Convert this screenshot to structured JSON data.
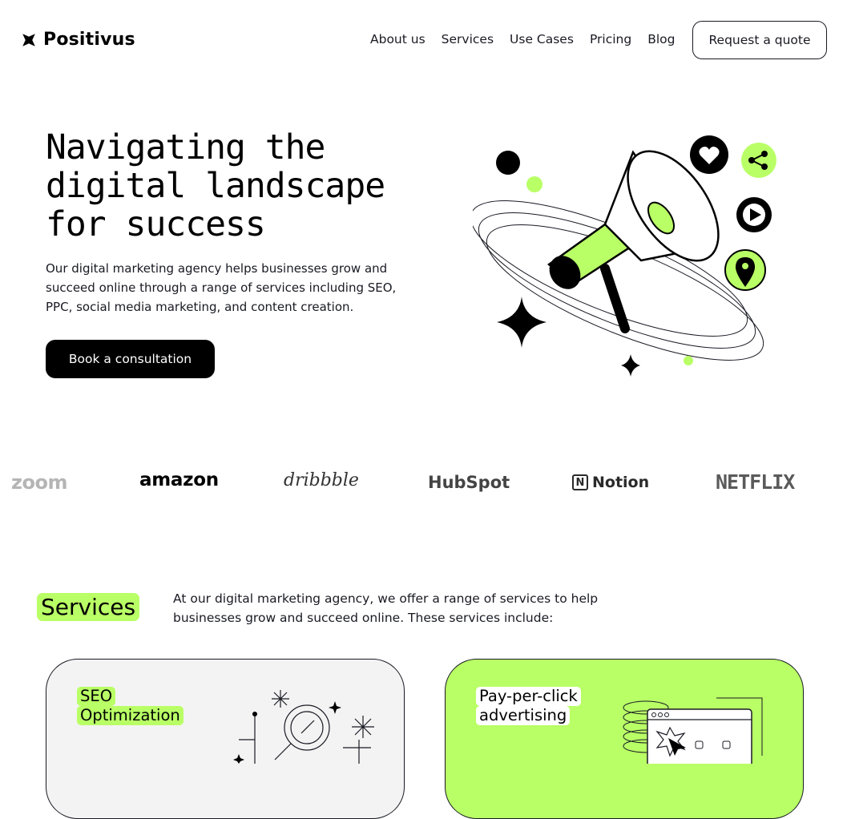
{
  "header": {
    "brand": "Positivus",
    "nav": [
      "About us",
      "Services",
      "Use Cases",
      "Pricing",
      "Blog"
    ],
    "quote_button": "Request a quote"
  },
  "hero": {
    "title": "Navigating the digital landscape for success",
    "description": "Our digital marketing agency helps businesses grow and succeed online through a range of services including SEO, PPC, social media marketing, and content creation.",
    "cta": "Book a consultation"
  },
  "logos": [
    "zoom",
    "amazon",
    "dribbble",
    "HubSpot",
    "Notion",
    "NETFLIX"
  ],
  "services": {
    "title": "Services",
    "description": "At our digital marketing agency, we offer a range of services to help businesses grow and succeed online. These services include:",
    "cards": [
      {
        "title_line1": "SEO",
        "title_line2": "Optimization"
      },
      {
        "title_line1": "Pay-per-click",
        "title_line2": "advertising"
      }
    ]
  },
  "colors": {
    "accent": "#b9ff66",
    "dark": "#191a23",
    "light_gray": "#f3f3f3"
  }
}
